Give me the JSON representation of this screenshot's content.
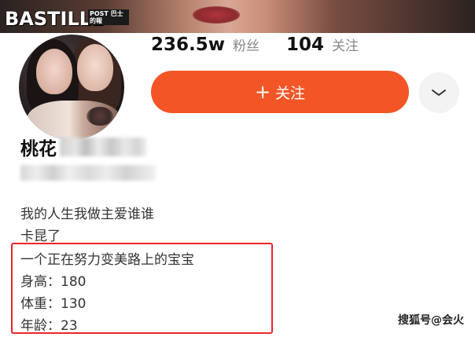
{
  "watermark": {
    "brand": "BASTILLE",
    "sub": "POST 巴士的報"
  },
  "stats": {
    "fans_count": "236.5w",
    "fans_label": "粉丝",
    "following_count": "104",
    "following_label": "关注"
  },
  "follow_button": {
    "plus": "+",
    "label": "关注"
  },
  "more_button": {
    "icon": "chevron-down-icon"
  },
  "profile": {
    "name": "桃花"
  },
  "bio": {
    "line1": "我的人生我做主爱谁谁",
    "line2": "卡昆了",
    "line3": "一个正在努力变美路上的宝宝",
    "line4": "身高：180",
    "line5": "体重：130",
    "line6": "年龄：23"
  },
  "source": "搜狐号@会火",
  "colors": {
    "accent": "#f25627",
    "highlight_border": "#e8262b"
  }
}
